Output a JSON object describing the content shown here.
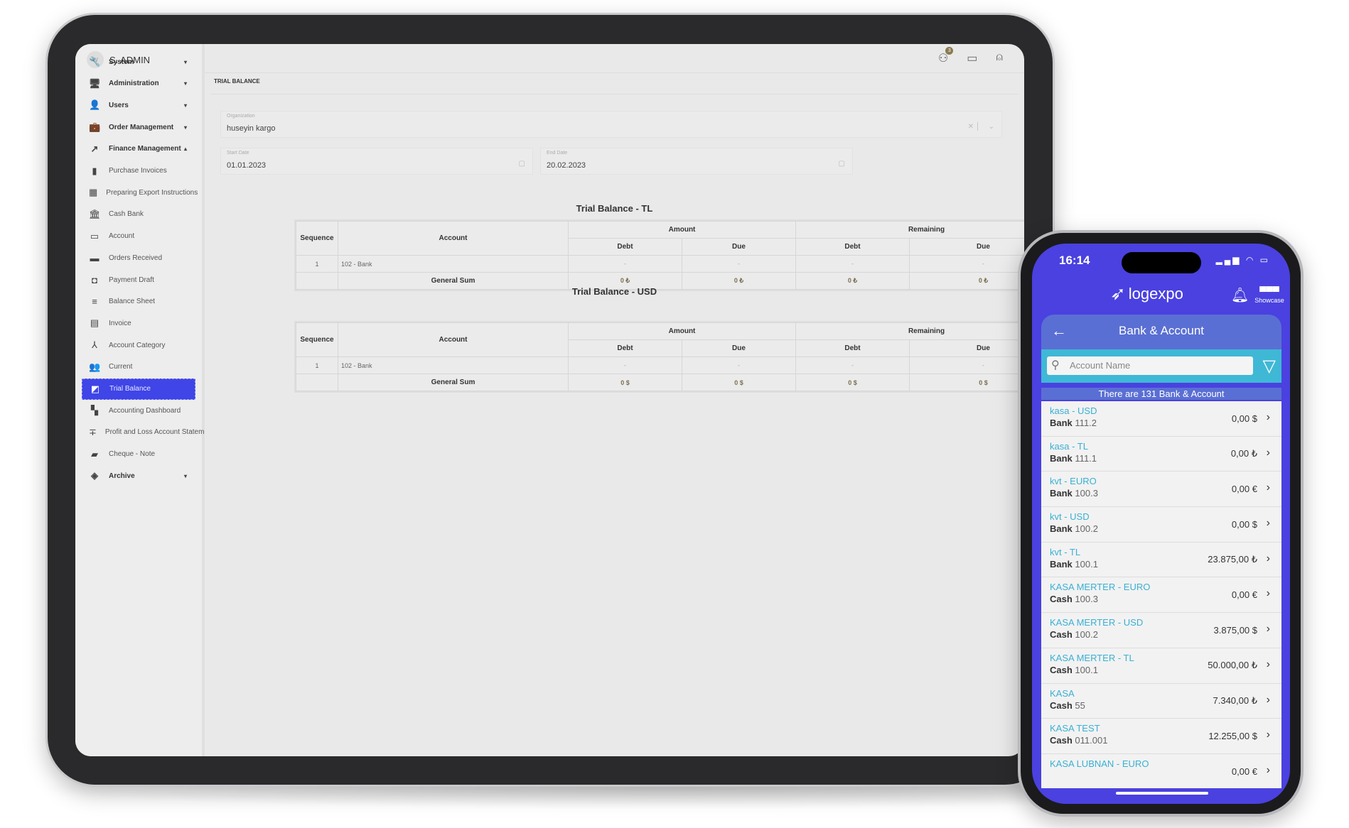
{
  "tablet": {
    "user": {
      "initials": "W",
      "name": "S. ADMIN"
    },
    "sidebar": {
      "items": [
        {
          "label": "System",
          "icon": "wrench-icon",
          "glyph": "🔧",
          "type": "bold",
          "caret": "▾"
        },
        {
          "label": "Administration",
          "icon": "admin-monitor-icon",
          "glyph": "🖥",
          "type": "bold",
          "caret": "▾"
        },
        {
          "label": "Users",
          "icon": "user-icon",
          "glyph": "👤",
          "type": "bold",
          "caret": "▾"
        },
        {
          "label": "Order Management",
          "icon": "briefcase-icon",
          "glyph": "💼",
          "type": "bold",
          "caret": "▾"
        },
        {
          "label": "Finance Management",
          "icon": "trending-up-icon",
          "glyph": "↗",
          "type": "bold",
          "caret": "▴"
        },
        {
          "label": "Purchase Invoices",
          "icon": "document-icon",
          "glyph": "▮",
          "type": "sub"
        },
        {
          "label": "Preparing Export Instructions",
          "icon": "bar-chart-icon",
          "glyph": "▦",
          "type": "sub"
        },
        {
          "label": "Cash Bank",
          "icon": "bank-icon",
          "glyph": "🏛",
          "type": "sub"
        },
        {
          "label": "Account",
          "icon": "credit-card-icon",
          "glyph": "▭",
          "type": "sub"
        },
        {
          "label": "Orders Received",
          "icon": "store-icon",
          "glyph": "▬",
          "type": "sub"
        },
        {
          "label": "Payment Draft",
          "icon": "wallet-icon",
          "glyph": "◘",
          "type": "sub"
        },
        {
          "label": "Balance Sheet",
          "icon": "lines-icon",
          "glyph": "≡",
          "type": "sub"
        },
        {
          "label": "Invoice",
          "icon": "calendar-icon",
          "glyph": "▤",
          "type": "sub"
        },
        {
          "label": "Account Category",
          "icon": "hierarchy-icon",
          "glyph": "⅄",
          "type": "sub"
        },
        {
          "label": "Current",
          "icon": "people-icon",
          "glyph": "👥",
          "type": "sub"
        },
        {
          "label": "Trial Balance",
          "icon": "balance-icon",
          "glyph": "◩",
          "type": "active"
        },
        {
          "label": "Accounting Dashboard",
          "icon": "dashboard-icon",
          "glyph": "▚",
          "type": "sub"
        },
        {
          "label": "Profit and Loss Account Statem",
          "icon": "adjust-icon",
          "glyph": "∓",
          "type": "sub"
        },
        {
          "label": "Cheque - Note",
          "icon": "cheque-icon",
          "glyph": "▰",
          "type": "sub"
        },
        {
          "label": "Archive",
          "icon": "layers-icon",
          "glyph": "◈",
          "type": "bold",
          "caret": "▾"
        }
      ]
    },
    "topbar": {
      "notification_count": "3"
    },
    "page_title": "TRIAL BALANCE",
    "filters": {
      "organization": {
        "label": "Organization",
        "value": "huseyin kargo"
      },
      "start_date": {
        "label": "Start Date",
        "value": "01.01.2023"
      },
      "end_date": {
        "label": "End Date",
        "value": "20.02.2023"
      }
    },
    "tables": [
      {
        "title": "Trial Balance - TL",
        "headers": {
          "sequence": "Sequence",
          "account": "Account",
          "amount": "Amount",
          "remaining": "Remaining",
          "debt": "Debt",
          "due": "Due"
        },
        "rows": [
          {
            "seq": "1",
            "account": "102 - Bank",
            "amount_debt": "-",
            "amount_due": "-",
            "rem_debt": "-",
            "rem_due": "-"
          }
        ],
        "sum": {
          "label": "General Sum",
          "amount_debt": "0 ₺",
          "amount_due": "0 ₺",
          "rem_debt": "0 ₺",
          "rem_due": "0 ₺"
        }
      },
      {
        "title": "Trial Balance - USD",
        "headers": {
          "sequence": "Sequence",
          "account": "Account",
          "amount": "Amount",
          "remaining": "Remaining",
          "debt": "Debt",
          "due": "Due"
        },
        "rows": [
          {
            "seq": "1",
            "account": "102 - Bank",
            "amount_debt": "-",
            "amount_due": "-",
            "rem_debt": "-",
            "rem_due": "-"
          }
        ],
        "sum": {
          "label": "General Sum",
          "amount_debt": "0 $",
          "amount_due": "0 $",
          "rem_debt": "0 $",
          "rem_due": "0 $"
        }
      }
    ]
  },
  "phone": {
    "time": "16:14",
    "brand": "logexpo",
    "showcase": "Showcase",
    "title": "Bank & Account",
    "search_placeholder": "Account Name",
    "count_text": "There are 131 Bank & Account",
    "accent": "#4a41e0",
    "accounts": [
      {
        "name": "kasa  - USD",
        "type": "Bank",
        "code": "111.2",
        "amount": "0,00 $"
      },
      {
        "name": "kasa  - TL",
        "type": "Bank",
        "code": "111.1",
        "amount": "0,00 ₺"
      },
      {
        "name": "kvt  - EURO",
        "type": "Bank",
        "code": "100.3",
        "amount": "0,00 €"
      },
      {
        "name": "kvt  - USD",
        "type": "Bank",
        "code": "100.2",
        "amount": "0,00 $"
      },
      {
        "name": "kvt  - TL",
        "type": "Bank",
        "code": "100.1",
        "amount": "23.875,00 ₺"
      },
      {
        "name": "KASA MERTER - EURO",
        "type": "Cash",
        "code": "100.3",
        "amount": "0,00 €"
      },
      {
        "name": "KASA MERTER - USD",
        "type": "Cash",
        "code": "100.2",
        "amount": "3.875,00 $"
      },
      {
        "name": "KASA MERTER - TL",
        "type": "Cash",
        "code": "100.1",
        "amount": "50.000,00 ₺"
      },
      {
        "name": "KASA",
        "type": "Cash",
        "code": "55",
        "amount": "7.340,00 ₺"
      },
      {
        "name": "KASA TEST",
        "type": "Cash",
        "code": "011.001",
        "amount": "12.255,00 $"
      },
      {
        "name": "KASA LUBNAN - EURO",
        "type": "",
        "code": "",
        "amount": "0,00 €"
      }
    ]
  }
}
